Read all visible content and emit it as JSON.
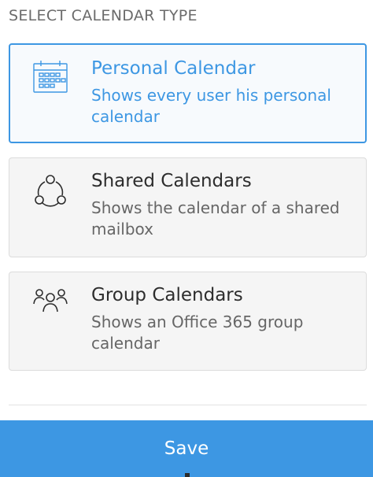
{
  "header": {
    "title": "SELECT CALENDAR TYPE"
  },
  "options": [
    {
      "title": "Personal Calendar",
      "description": "Shows every user his personal calendar",
      "icon": "calendar-icon",
      "selected": true
    },
    {
      "title": "Shared Calendars",
      "description": "Shows the calendar of a shared mailbox",
      "icon": "share-network-icon",
      "selected": false
    },
    {
      "title": "Group Calendars",
      "description": "Shows an Office 365 group calendar",
      "icon": "group-icon",
      "selected": false
    }
  ],
  "footer": {
    "save_label": "Save"
  },
  "colors": {
    "accent": "#3d97e3",
    "card_bg": "#f5f5f5",
    "border": "#dcdcdc",
    "text": "#2d2d2d",
    "muted": "#666666"
  }
}
